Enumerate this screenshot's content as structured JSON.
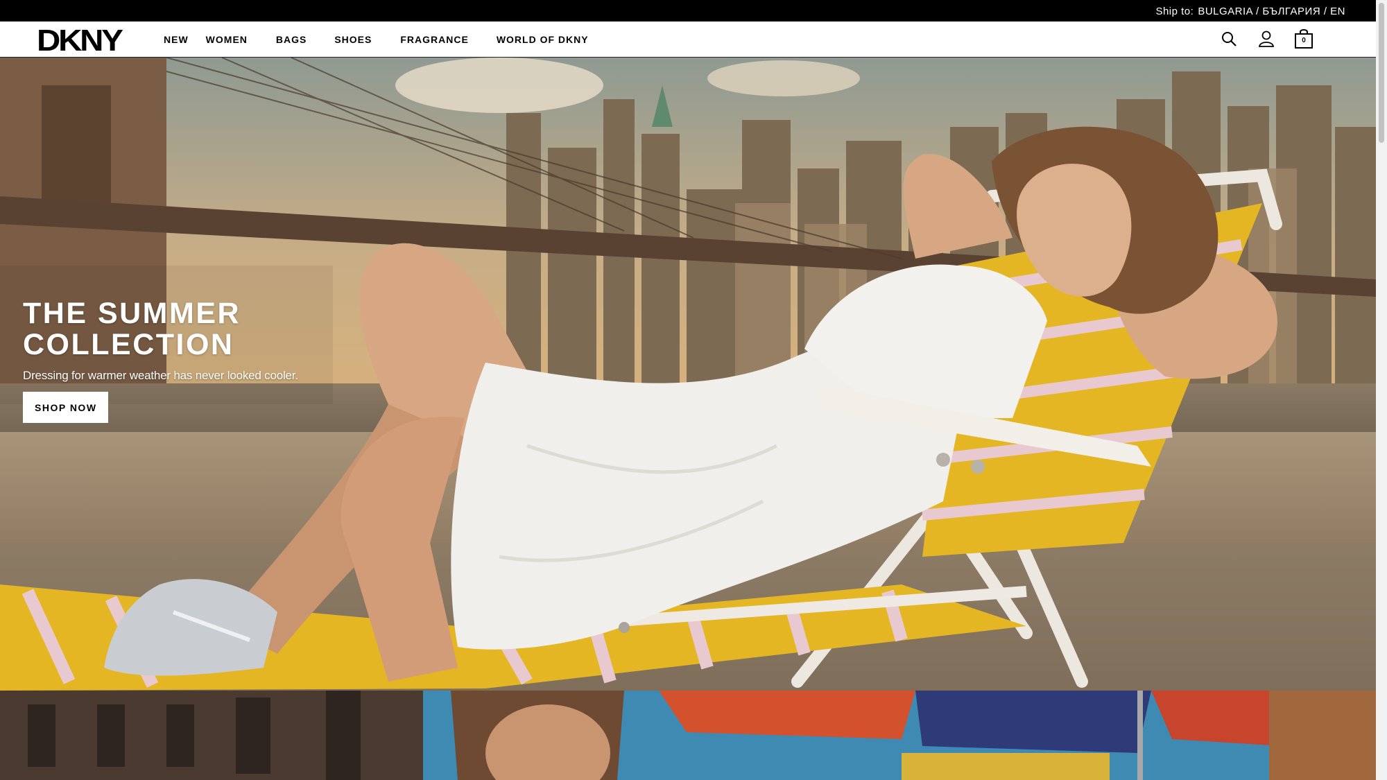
{
  "topbar": {
    "ship_label": "Ship to:",
    "ship_value": "BULGARIA / БЪЛГАРИЯ / EN"
  },
  "header": {
    "logo": "DKNY",
    "nav": [
      "NEW",
      "WOMEN",
      "BAGS",
      "SHOES",
      "FRAGRANCE",
      "WORLD OF DKNY"
    ],
    "icons": [
      "search-icon",
      "account-icon",
      "bag-icon"
    ],
    "bag_count": "0"
  },
  "hero": {
    "title": "THE SUMMER COLLECTION",
    "subtitle": "Dressing for warmer weather has never looked cooler.",
    "cta": "SHOP NOW"
  },
  "colors": {
    "topbar_bg": "#000000",
    "accent_yellow": "#e6b820",
    "sky": "#d9b47a"
  }
}
